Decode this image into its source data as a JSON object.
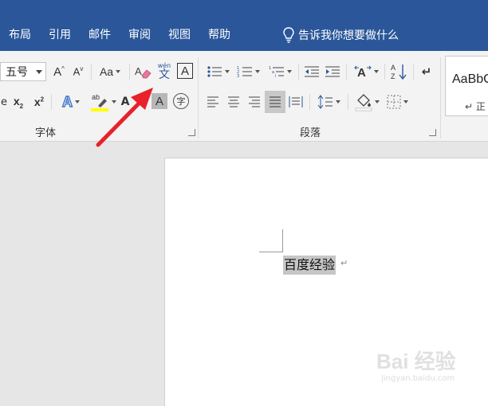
{
  "menu": {
    "tabs": [
      "布局",
      "引用",
      "邮件",
      "审阅",
      "视图",
      "帮助"
    ],
    "tell_me": "告诉我你想要做什么"
  },
  "ribbon": {
    "font_group": {
      "label": "字体",
      "font_size": "五号",
      "change_case": "Aa",
      "phonetic_top": "wén",
      "phonetic_bottom": "文",
      "border_char": "A",
      "shading_char": "A",
      "enclose_char": "字"
    },
    "paragraph_group": {
      "label": "段落"
    },
    "styles": {
      "sample": "AaBbC",
      "normal_mark": "↵ 正"
    }
  },
  "document": {
    "text": "百度经验",
    "paragraph_mark": "↵"
  },
  "watermark": {
    "brand": "Bai 经验",
    "url": "jingyan.baidu.com"
  },
  "colors": {
    "menubar": "#2b579a",
    "arrow": "#e8212a",
    "highlight": "#ffff00",
    "selection": "#c6c6c6"
  }
}
